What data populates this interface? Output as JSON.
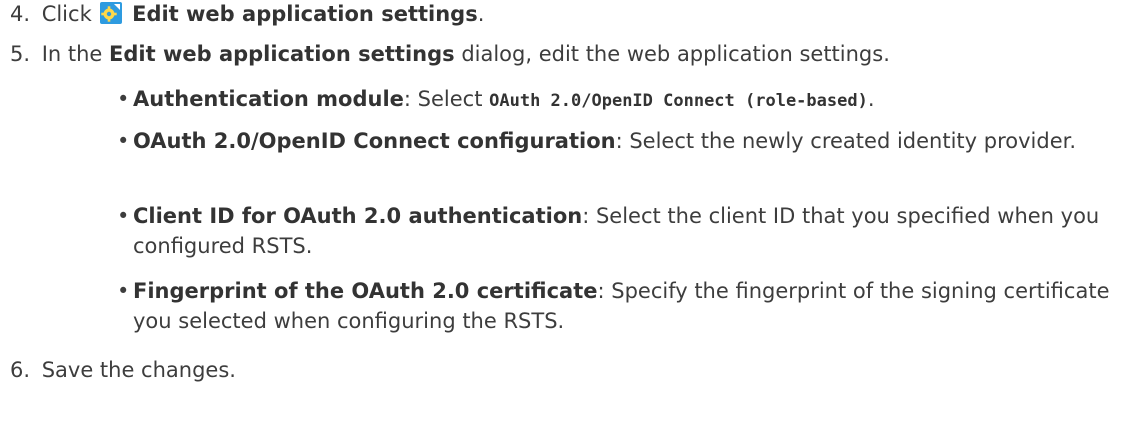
{
  "steps": [
    {
      "number": "4.",
      "prefix": "Click",
      "bold": "Edit web application settings",
      "suffix": "."
    },
    {
      "number": "5.",
      "prefix": "In the",
      "bold": "Edit web application settings",
      "suffix": "dialog, edit the web application settings."
    },
    {
      "number": "6.",
      "text": "Save the changes."
    }
  ],
  "bullets": [
    {
      "label": "Authentication module",
      "sep": ": Select",
      "code": "OAuth 2.0/OpenID Connect (role-based)",
      "end": "."
    },
    {
      "label": "OAuth 2.0/OpenID Connect configuration",
      "text": ": Select the newly created identity provider."
    },
    {
      "label": "Client ID for OAuth 2.0 authentication",
      "text": ": Select the client ID that you specified when you configured RSTS."
    },
    {
      "label": "Fingerprint of the OAuth 2.0 certificate",
      "text": ": Specify the fingerprint of the signing certificate you selected when configuring the RSTS."
    }
  ],
  "bullet_symbol": "•",
  "icon": "settings-gear-icon",
  "colors": {
    "text": "#3d3d3d",
    "icon_bg": "#2e9be0",
    "icon_fg": "#ffd84a"
  }
}
